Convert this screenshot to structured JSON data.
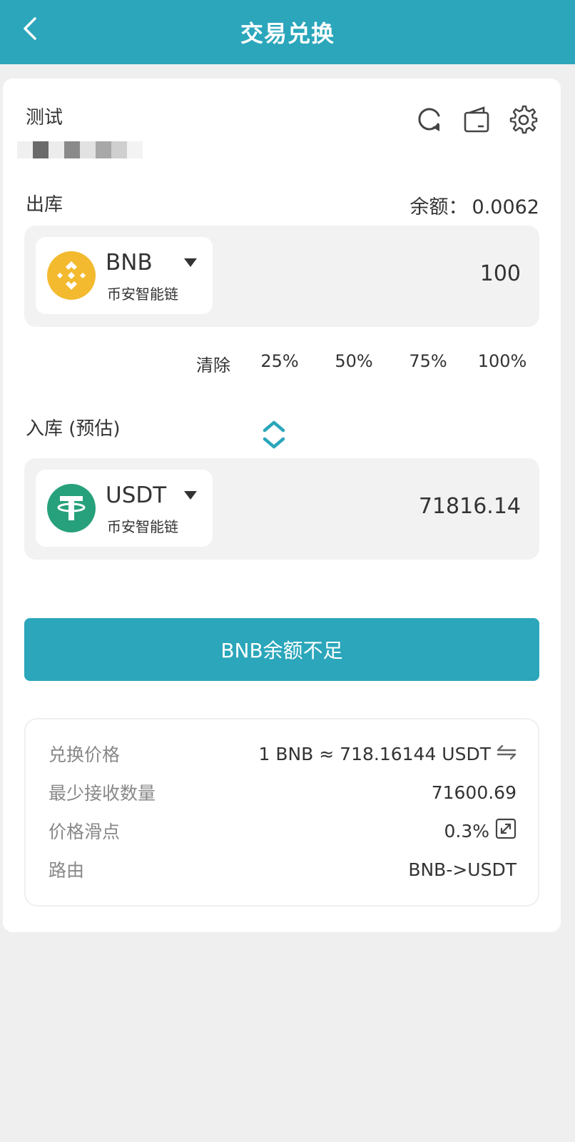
{
  "header": {
    "title": "交易兑换"
  },
  "wallet": {
    "name": "测试"
  },
  "out_section": {
    "label": "出库",
    "balance_label": "余额：",
    "balance_value": "0.0062",
    "token": {
      "symbol": "BNB",
      "chain": "币安智能链"
    },
    "amount": "100"
  },
  "percent_options": [
    "清除",
    "25%",
    "50%",
    "75%",
    "100%"
  ],
  "in_section": {
    "label": "入库 (预估)",
    "token": {
      "symbol": "USDT",
      "chain": "币安智能链"
    },
    "amount": "71816.14"
  },
  "action_button": {
    "label": "BNB余额不足"
  },
  "info": [
    {
      "key": "兑换价格",
      "value": "1 BNB ≈ 718.16144 USDT",
      "icon": "swap-arrows-icon"
    },
    {
      "key": "最少接收数量",
      "value": "71600.69",
      "icon": ""
    },
    {
      "key": "价格滑点",
      "value": "0.3%",
      "icon": "expand-icon"
    },
    {
      "key": "路由",
      "value": "BNB->USDT",
      "icon": ""
    }
  ],
  "colors": {
    "primary": "#2ba6bb",
    "bnb": "#f3ba2f",
    "usdt": "#26a17b",
    "background": "#efefef"
  }
}
